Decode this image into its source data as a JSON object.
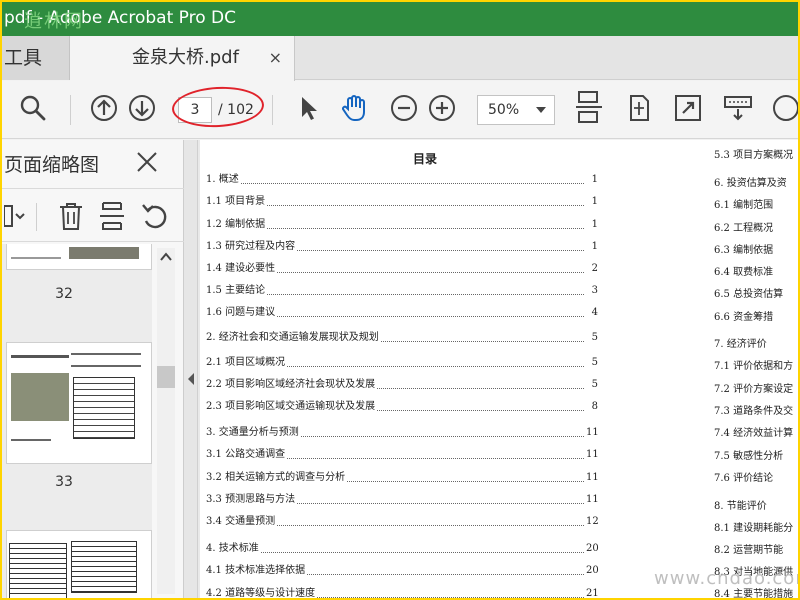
{
  "app": {
    "title": "pdf - Adobe Acrobat Pro DC",
    "watermark_logo": "逍林网"
  },
  "tabs": {
    "tools_label": "工具",
    "doc_label": "金泉大桥.pdf",
    "close_glyph": "×"
  },
  "toolbar": {
    "current_page": "3",
    "total_pages": "/ 102",
    "zoom": "50%"
  },
  "left_panel": {
    "title": "页面缩略图",
    "thumbs": [
      {
        "label": "32"
      },
      {
        "label": "33"
      },
      {
        "label": ""
      }
    ]
  },
  "doc": {
    "toc_title": "目录",
    "toc": [
      {
        "t": "1.    概述",
        "p": "1"
      },
      {
        "t": "1.1 项目背景",
        "p": "1"
      },
      {
        "t": "1.2 编制依据",
        "p": "1"
      },
      {
        "t": "1.3 研究过程及内容",
        "p": "1"
      },
      {
        "t": "1.4 建设必要性",
        "p": "2"
      },
      {
        "t": "1.5 主要结论",
        "p": "3"
      },
      {
        "t": "1.6 问题与建议",
        "p": "4"
      },
      {
        "t": "2.    经济社会和交通运输发展现状及规划",
        "p": "5"
      },
      {
        "t": "2.1 项目区域概况",
        "p": "5"
      },
      {
        "t": "2.2 项目影响区域经济社会现状及发展",
        "p": "5"
      },
      {
        "t": "2.3 项目影响区域交通运输现状及发展",
        "p": "8"
      },
      {
        "t": "3.    交通量分析与预测",
        "p": "11"
      },
      {
        "t": "3.1 公路交通调查",
        "p": "11"
      },
      {
        "t": "3.2 相关运输方式的调查与分析",
        "p": "11"
      },
      {
        "t": "3.3 预测思路与方法",
        "p": "11"
      },
      {
        "t": "3.4 交通量预测",
        "p": "12"
      },
      {
        "t": "4.    技术标准",
        "p": "20"
      },
      {
        "t": "4.1 技术标准选择依据",
        "p": "20"
      },
      {
        "t": "4.2 道路等级与设计速度",
        "p": "21"
      }
    ],
    "right_col": [
      "5.3 项目方案概况",
      "6.    投资估算及资",
      "6.1 编制范围",
      "6.2 工程概况",
      "6.3 编制依据",
      "6.4 取费标准",
      "6.5 总投资估算",
      "6.6 资金筹措",
      "7.    经济评价",
      "7.1 评价依据和方",
      "7.2 评价方案设定",
      "7.3 道路条件及交",
      "7.4 经济效益计算",
      "7.5 敏感性分析",
      "7.6 评价结论",
      "8.    节能评价",
      "8.1 建设期耗能分",
      "8.2 运营期节能",
      "8.3 对当地能源供",
      "8.4 主要节能措施"
    ]
  },
  "site_watermark": "www.cndao.com"
}
